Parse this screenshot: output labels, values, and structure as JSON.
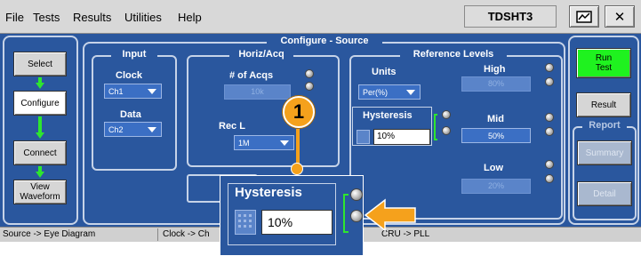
{
  "menu": {
    "file": "File",
    "tests": "Tests",
    "results": "Results",
    "utilities": "Utilities",
    "help": "Help"
  },
  "app_name": "TDSHT3",
  "sidebar": {
    "select": "Select",
    "configure": "Configure",
    "connect": "Connect",
    "view_line1": "View",
    "view_line2": "Waveform"
  },
  "panel_title": "Configure - Source",
  "input": {
    "header": "Input",
    "clock_label": "Clock",
    "clock_value": "Ch1",
    "data_label": "Data",
    "data_value": "Ch2"
  },
  "horiz": {
    "header": "Horiz/Acq",
    "acqs_label": "# of Acqs",
    "acqs_value": "10k",
    "reclen_label": "Rec L",
    "reclen_value": "1M"
  },
  "ref": {
    "header": "Reference Levels",
    "units_label": "Units",
    "units_value": "Per(%)",
    "high_label": "High",
    "high_value": "80%",
    "hyst_label": "Hysteresis",
    "hyst_value": "10%",
    "mid_label": "Mid",
    "mid_value": "50%",
    "low_label": "Low",
    "low_value": "20%"
  },
  "right": {
    "run_line1": "Run",
    "run_line2": "Test",
    "result": "Result",
    "report": "Report",
    "summary": "Summary",
    "detail": "Detail"
  },
  "status": {
    "s1": "Source -> Eye Diagram",
    "s2": "Clock -> Ch",
    "s3": "CRU -> PLL"
  },
  "callout": {
    "number": "1",
    "hyst_label": "Hysteresis",
    "hyst_value": "10%"
  },
  "colors": {
    "accent_orange": "#f5a11c",
    "run_green": "#1ff21f",
    "panel_blue": "#2a579e"
  }
}
